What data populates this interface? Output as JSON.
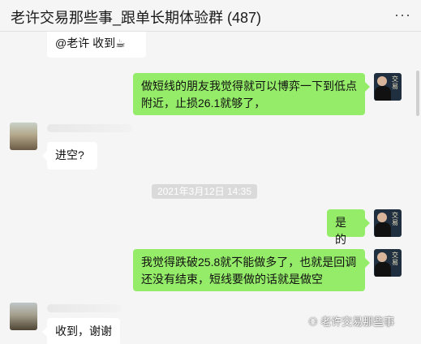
{
  "header": {
    "title": "老许交易那些事_跟单长期体验群 (487)",
    "more": "···"
  },
  "messages": {
    "m1": "@老许 收到☕",
    "m2": "做短线的朋友我觉得就可以博弈一下到低点附近，止损26.1就够了，",
    "m3": "进空?",
    "timestamp": "2021年3月12日 14:35",
    "m4": "是的",
    "m5": "我觉得跌破25.8就不能做多了，也就是回调还没有结束，短线要做的话就是做空",
    "m6": "收到，谢谢"
  },
  "watermark": {
    "text": "老许交易那些事"
  },
  "avatar_text": "交易"
}
